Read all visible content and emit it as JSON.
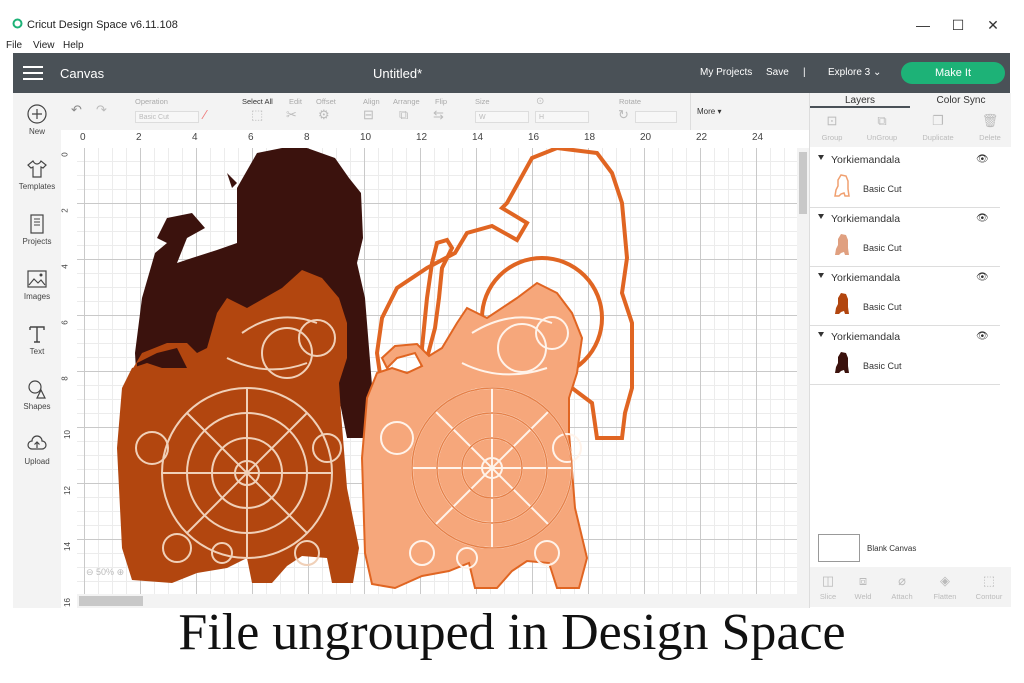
{
  "window": {
    "app_title": "Cricut Design Space",
    "version": "v6.11.108",
    "minimize_glyph": "—",
    "maximize_glyph": "☐",
    "close_glyph": "✕"
  },
  "menu": [
    "File",
    "View",
    "Help"
  ],
  "header": {
    "section": "Canvas",
    "document_title": "Untitled*",
    "my_projects": "My Projects",
    "save": "Save",
    "separator": "|",
    "machine": "Explore 3",
    "make_it": "Make It",
    "brand_color": "#1db277"
  },
  "sidebar": {
    "items": [
      {
        "label": "New",
        "icon": "plus-circle-icon"
      },
      {
        "label": "Templates",
        "icon": "shirt-icon"
      },
      {
        "label": "Projects",
        "icon": "book-icon"
      },
      {
        "label": "Images",
        "icon": "image-icon"
      },
      {
        "label": "Text",
        "icon": "text-icon"
      },
      {
        "label": "Shapes",
        "icon": "shapes-icon"
      },
      {
        "label": "Upload",
        "icon": "upload-cloud-icon"
      }
    ]
  },
  "toolbar": {
    "operation_label": "Operation",
    "operation_value": "Basic Cut",
    "select_all": "Select All",
    "edit": "Edit",
    "offset": "Offset",
    "align": "Align",
    "arrange": "Arrange",
    "flip": "Flip",
    "size": "Size",
    "size_w": "W",
    "size_h": "H",
    "rotate": "Rotate",
    "more": "More"
  },
  "ruler": {
    "h_ticks": [
      "0",
      "2",
      "4",
      "6",
      "8",
      "10",
      "12",
      "14",
      "16",
      "18",
      "20",
      "22",
      "24"
    ],
    "v_ticks": [
      "0",
      "2",
      "4",
      "6",
      "8",
      "10",
      "12",
      "14",
      "16"
    ]
  },
  "canvas": {
    "zoom": "50%",
    "colors": {
      "dark": "#3b120d",
      "rust": "#b2460f",
      "orange_outline": "#e06522",
      "peach": "#f6a77b"
    }
  },
  "panel": {
    "tabs": [
      "Layers",
      "Color Sync"
    ],
    "tools": [
      "Group",
      "UnGroup",
      "Duplicate",
      "Delete"
    ],
    "layers": [
      {
        "name": "Yorkiemandala",
        "sub": "Basic Cut",
        "color": "#f0a070"
      },
      {
        "name": "Yorkiemandala",
        "sub": "Basic Cut",
        "color": "#e0a080"
      },
      {
        "name": "Yorkiemandala",
        "sub": "Basic Cut",
        "color": "#b2460f"
      },
      {
        "name": "Yorkiemandala",
        "sub": "Basic Cut",
        "color": "#3b120d"
      }
    ],
    "blank_canvas": "Blank Canvas",
    "bottom_tools": [
      "Slice",
      "Weld",
      "Attach",
      "Flatten",
      "Contour"
    ]
  },
  "caption": "File ungrouped in Design Space"
}
